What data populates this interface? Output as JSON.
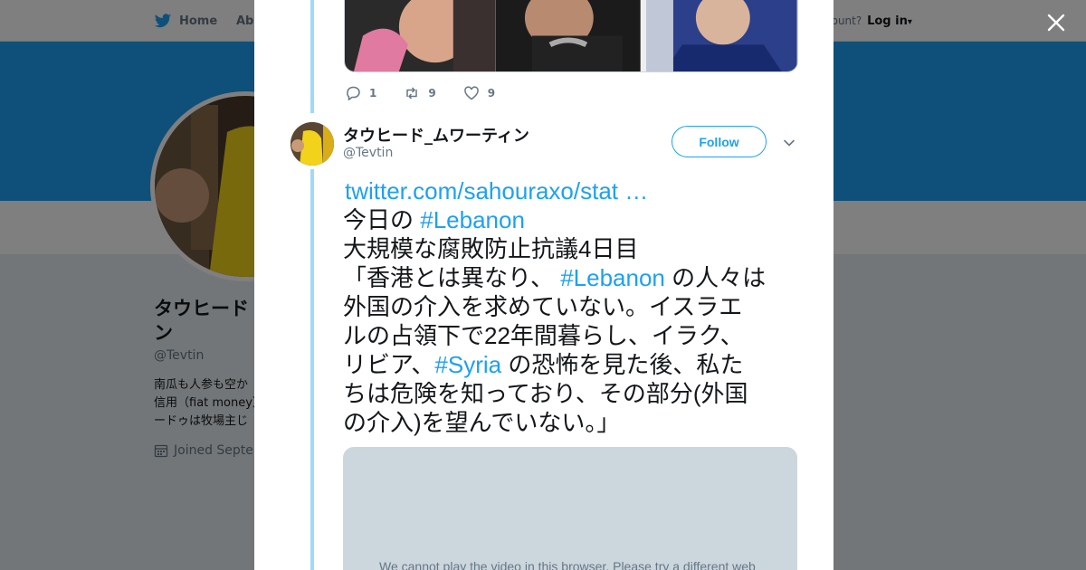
{
  "nav": {
    "home_label": "Home",
    "about_label": "Abo",
    "account_prompt": "count?",
    "login_label": "Log in"
  },
  "profile": {
    "name": "タウヒード_ムワーティン",
    "name_visible": "タウヒードン",
    "handle": "@Tevtin",
    "bio_line1": "南瓜も人参も空か",
    "bio_line2": "信用（fiat money）",
    "bio_line3": "ードゥは牧場主じ",
    "joined": "Joined Septen"
  },
  "previous_tweet": {
    "reply_count": "1",
    "retweet_count": "9",
    "like_count": "9"
  },
  "tweet": {
    "author_name": "タウヒード_ムワーティン",
    "author_handle": "@Tevtin",
    "follow_label": "Follow",
    "link": "twitter.com/sahouraxo/stat …",
    "line2_prefix": "今日の ",
    "hashtag_lebanon": "#Lebanon",
    "line3": "大規模な腐敗防止抗議4日目",
    "line4_prefix": "「香港とは異なり、 ",
    "line4_suffix": " の人々は",
    "line5": "外国の介入を求めていない。イスラエ",
    "line6": "ルの占領下で22年間暮らし、イラク、",
    "line7_prefix": "リビア、",
    "hashtag_syria": "#Syria",
    "line7_suffix": " の恐怖を見た後、私た",
    "line8": "ちは危険を知っており、その部分(外国",
    "line9": "の介入)を望んでいない。」",
    "video_message": "We cannot play the video in this browser. Please try a different web"
  },
  "colors": {
    "accent": "#1da1f2",
    "thread": "#a0d9f7",
    "muted": "#657786"
  },
  "icons": [
    "twitter-bird-icon",
    "close-icon",
    "reply-icon",
    "retweet-icon",
    "like-icon",
    "chevron-down-icon",
    "calendar-icon"
  ]
}
